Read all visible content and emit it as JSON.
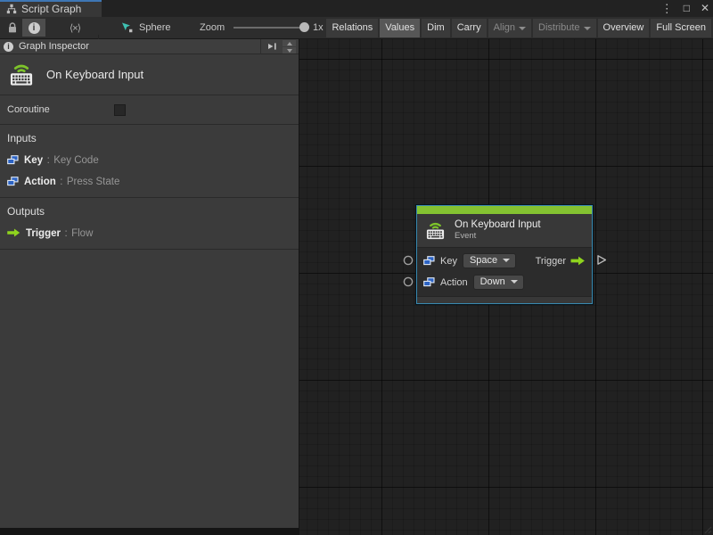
{
  "window": {
    "tab_title": "Script Graph",
    "controls": {
      "menu_icon": "⋮",
      "maximize_icon": "□",
      "close_icon": "✕"
    }
  },
  "toolbar": {
    "code_icon_glyph": "⟨×⟩",
    "graph_name": "Sphere",
    "zoom_label": "Zoom",
    "zoom_value": "1x",
    "buttons": [
      {
        "label": "Relations",
        "state": "normal"
      },
      {
        "label": "Values",
        "state": "active"
      },
      {
        "label": "Dim",
        "state": "normal"
      },
      {
        "label": "Carry",
        "state": "normal"
      },
      {
        "label": "Align",
        "state": "disabled",
        "dropdown": true
      },
      {
        "label": "Distribute",
        "state": "disabled",
        "dropdown": true
      },
      {
        "label": "Overview",
        "state": "normal"
      },
      {
        "label": "Full Screen",
        "state": "normal"
      }
    ]
  },
  "inspector": {
    "title": "Graph Inspector",
    "unit_title": "On Keyboard Input",
    "coroutine_label": "Coroutine",
    "coroutine_checked": false,
    "type_separator": ":",
    "inputs_heading": "Inputs",
    "inputs": [
      {
        "name": "Key",
        "type": "Key Code"
      },
      {
        "name": "Action",
        "type": "Press State"
      }
    ],
    "outputs_heading": "Outputs",
    "outputs": [
      {
        "name": "Trigger",
        "type": "Flow"
      }
    ]
  },
  "node": {
    "title": "On Keyboard Input",
    "subtitle": "Event",
    "ports": [
      {
        "label": "Key",
        "value": "Space"
      },
      {
        "label": "Action",
        "value": "Down"
      }
    ],
    "output_port_label": "Trigger"
  },
  "colors": {
    "accent_green": "#84c331",
    "flow_green": "#8fd41e",
    "port_blue": "#2c63c4",
    "selection_blue": "#3a89af",
    "tab_focus_blue": "#3e76b4",
    "canvas_bg": "#212121",
    "panel_bg": "#3b3b3b"
  }
}
